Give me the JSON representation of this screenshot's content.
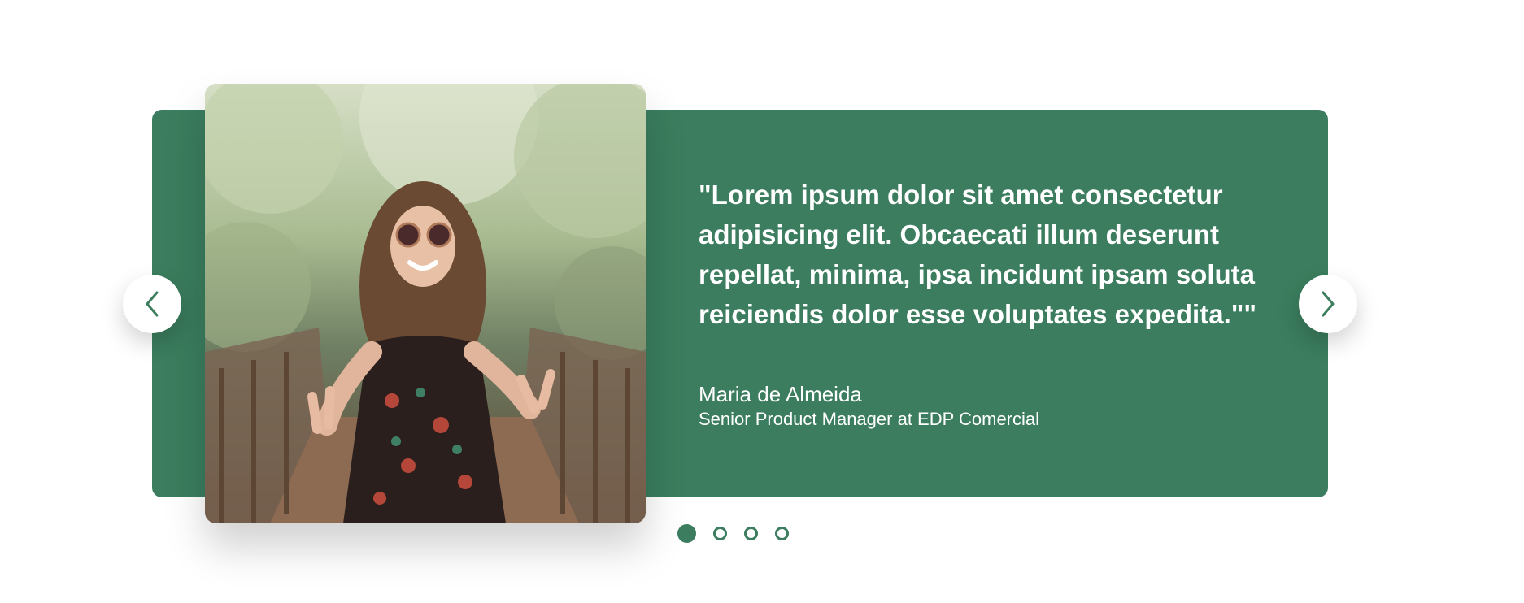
{
  "testimonial": {
    "quote": "\"Lorem ipsum dolor sit amet consectetur adipisicing elit. Obcaecati illum deserunt repellat, minima, ipsa incidunt ipsam soluta reiciendis dolor esse voluptates expedita.\"\"",
    "author": "Maria de Almeida",
    "role": "Senior Product Manager at EDP Comercial"
  },
  "colors": {
    "card_background": "#3b7d5e",
    "text": "#ffffff",
    "accent": "#3b7d5e"
  },
  "icons": {
    "prev": "chevron-left-icon",
    "next": "chevron-right-icon"
  },
  "pagination": {
    "total": 4,
    "active_index": 0
  }
}
